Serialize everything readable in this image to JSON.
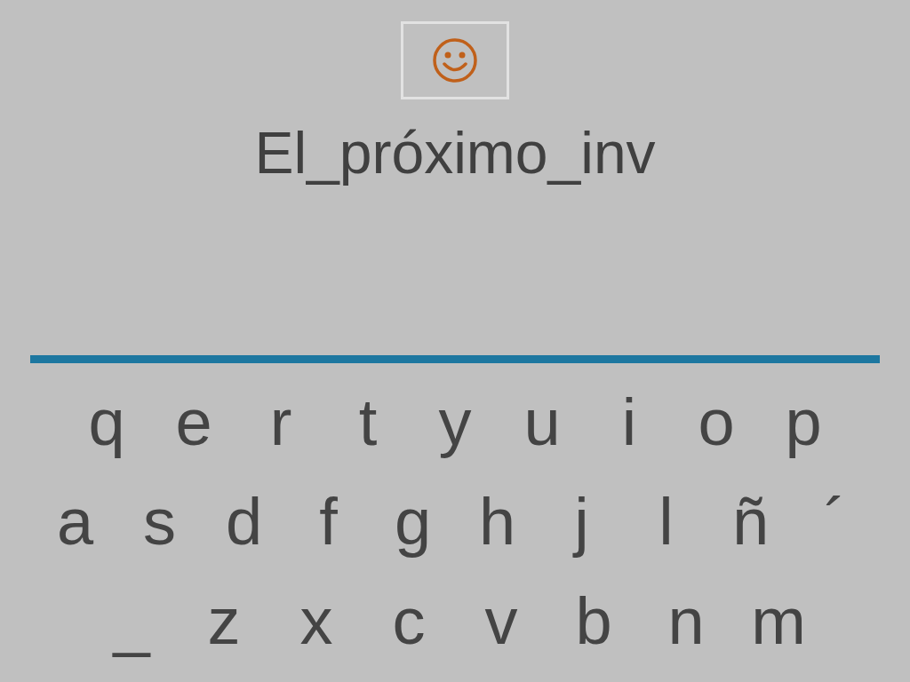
{
  "typed_text": "El_próximo_inv",
  "keyboard": {
    "rows": [
      [
        "q",
        "e",
        "r",
        "t",
        "y",
        "u",
        "i",
        "o",
        "p"
      ],
      [
        "a",
        "s",
        "d",
        "f",
        "g",
        "h",
        "j",
        "l",
        "ñ",
        "´"
      ],
      [
        "_",
        "z",
        "x",
        "c",
        "v",
        "b",
        "n",
        "m"
      ]
    ]
  }
}
